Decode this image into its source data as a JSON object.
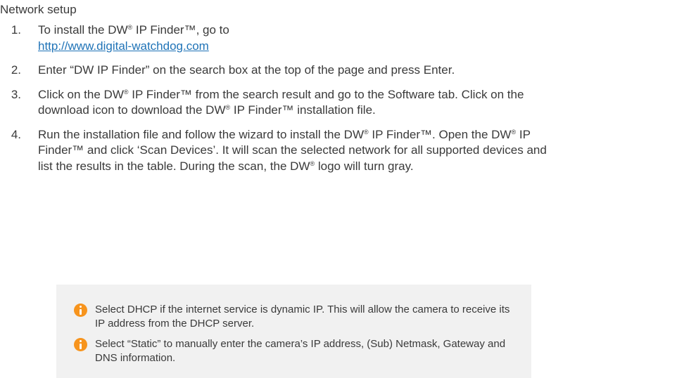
{
  "section": {
    "title": "Network setup"
  },
  "steps": [
    {
      "number": "1.",
      "text": "To install the DW® IP Finder™, go to",
      "link": "http://www.digital-watchdog.com"
    },
    {
      "number": "2.",
      "text": "Enter “DW IP Finder” on the search box at the top of the page and press Enter."
    },
    {
      "number": "3.",
      "text": "Click on the DW® IP Finder™ from the search result and go to the Software tab. Click on the download icon to download the DW® IP Finder™ installation file."
    },
    {
      "number": "4.",
      "text": "Run the installation file and follow the wizard to install the DW® IP Finder™. Open the DW® IP Finder™ and click ‘Scan Devices’. It will scan the selected network for all supported devices and list the results in the table. During the scan, the DW® logo will turn gray."
    }
  ],
  "notes": [
    {
      "icon": "info-icon",
      "icon_color": "#f7941d",
      "text": "Select DHCP if the internet service is dynamic IP. This will allow the camera to receive its IP address from the DHCP server."
    },
    {
      "icon": "info-icon",
      "icon_color": "#f7941d",
      "text": "Select “Static” to manually enter the camera’s IP address, (Sub) Netmask, Gateway and DNS information."
    }
  ],
  "colors": {
    "link": "#1f73b7",
    "note_background": "#f1f1f1",
    "text": "#3a3a3a"
  }
}
